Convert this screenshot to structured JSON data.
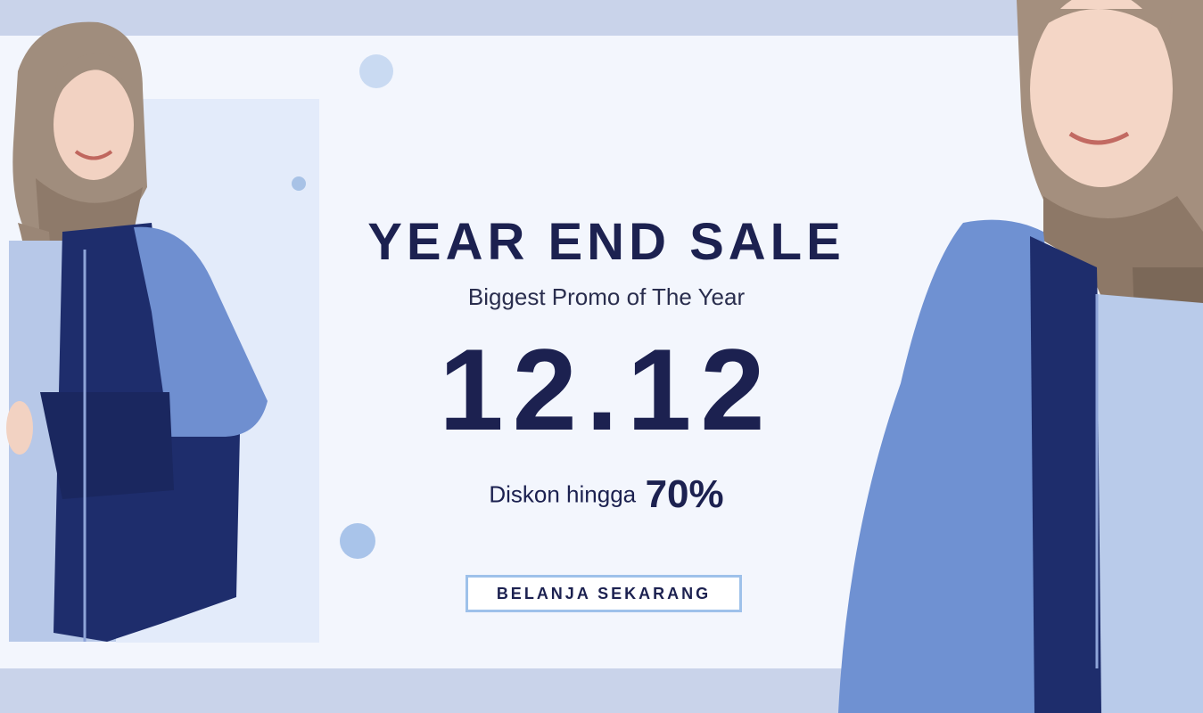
{
  "banner": {
    "headline": "YEAR END SALE",
    "subtitle": "Biggest Promo of The Year",
    "date": "12.12",
    "discount_label": "Diskon hingga",
    "discount_value": "70%",
    "cta_label": "BELANJA SEKARANG"
  },
  "colors": {
    "text_navy": "#1c2150",
    "background": "#f3f6fd",
    "band": "#c9d3ea",
    "accent_blue": "#9ec1ea"
  }
}
